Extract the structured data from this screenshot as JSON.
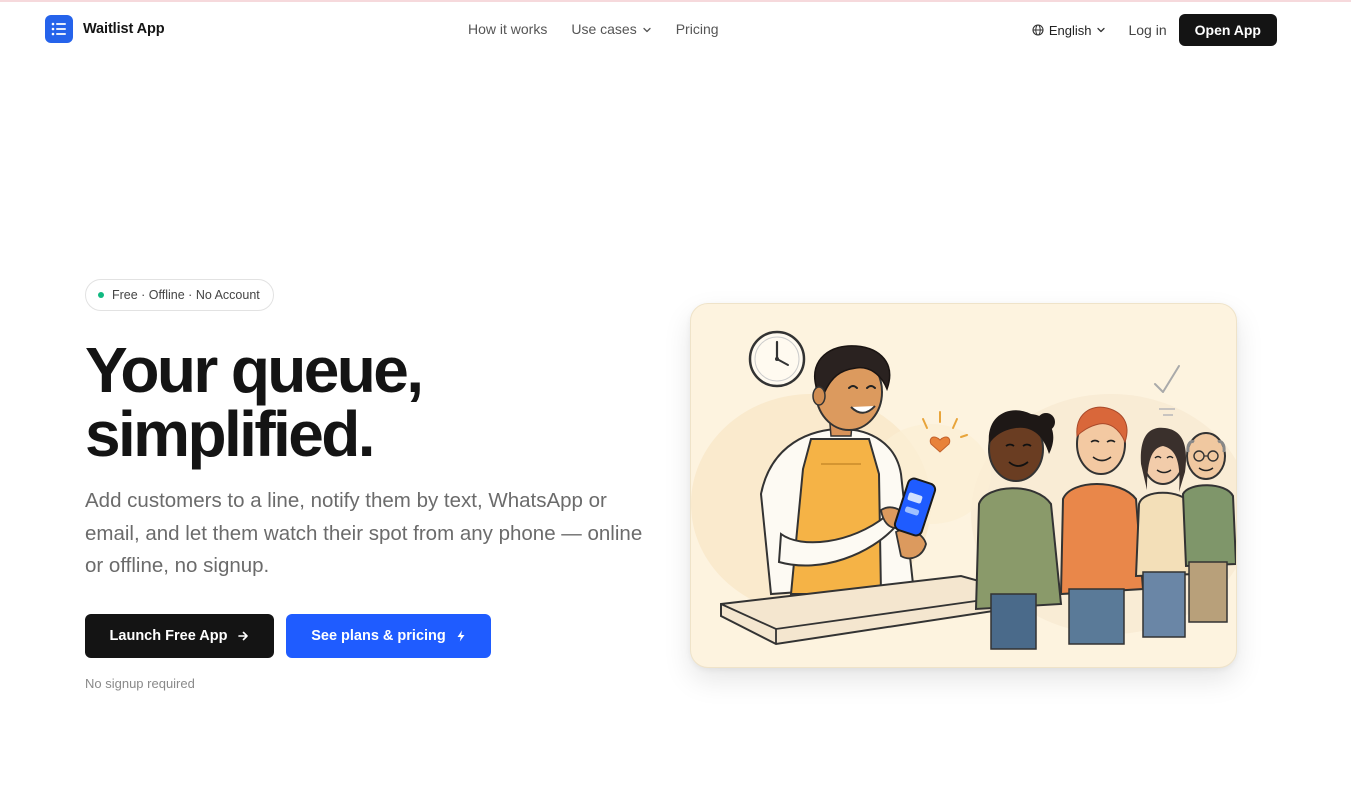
{
  "brand": {
    "name": "Waitlist App",
    "logo_icon": "list-icon",
    "accent": "#2563eb"
  },
  "nav": {
    "items": [
      {
        "label": "How it works"
      },
      {
        "label": "Use cases",
        "icon": "chevron-down-icon"
      },
      {
        "label": "Pricing"
      }
    ]
  },
  "header_right": {
    "language": "English",
    "login": "Log in",
    "open_app": "Open App"
  },
  "hero": {
    "badge": "Free · Offline · No Account",
    "badge_color": "#10b981",
    "headline_line1": "Your queue,",
    "headline_line2": "simplified.",
    "subtext": "Add customers to a line, notify them by text, WhatsApp or email, and let them watch their spot from any phone — online or offline, no signup.",
    "primary_cta": "Launch Free App",
    "secondary_cta": "See plans & pricing",
    "primary_color": "#141414",
    "secondary_color": "#1f5cff",
    "note": "No signup required"
  }
}
